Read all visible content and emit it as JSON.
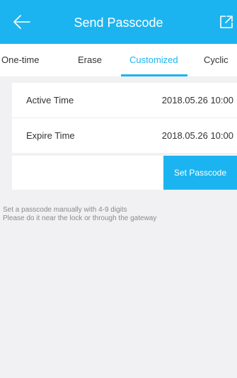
{
  "header": {
    "title": "Send Passcode",
    "back_icon": "arrow-left-icon",
    "share_icon": "share-external-icon",
    "color": "#1cb4f0"
  },
  "tabs": [
    {
      "label": "One-time",
      "active": false
    },
    {
      "label": "Erase",
      "active": false
    },
    {
      "label": "Customized",
      "active": true
    },
    {
      "label": "Cyclic",
      "active": false
    }
  ],
  "time_settings": {
    "active_time": {
      "label": "Active Time",
      "value": "2018.05.26 10:00"
    },
    "expire_time": {
      "label": "Expire Time",
      "value": "2018.05.26 10:00"
    }
  },
  "passcode": {
    "value": "",
    "button_label": "Set Passcode"
  },
  "hints": [
    "Set a passcode manually with 4-9 digits",
    "Please do it near the lock or through the gateway"
  ]
}
